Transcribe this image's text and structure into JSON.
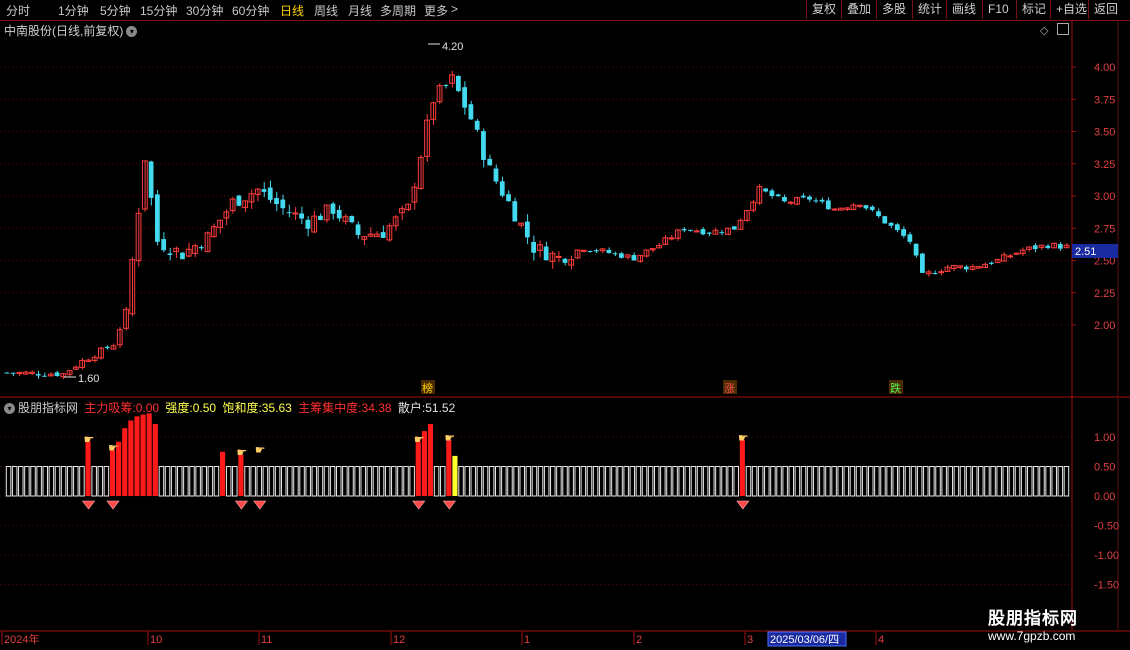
{
  "toolbar": {
    "periods": [
      "分时",
      "1分钟",
      "5分钟",
      "15分钟",
      "30分钟",
      "60分钟",
      "日线",
      "周线",
      "月线",
      "多周期",
      "更多"
    ],
    "active_period": "日线",
    "more_arrow": ">",
    "right_buttons": [
      "复权",
      "叠加",
      "多股",
      "统计",
      "画线",
      "F10",
      "标记",
      "+自选",
      "返回"
    ]
  },
  "main_panel": {
    "title": "中南股份(日线,前复权)",
    "high_label": "4.20",
    "low_label": "1.60",
    "current_price": "2.51",
    "y_ticks": [
      "4.00",
      "3.75",
      "3.50",
      "3.25",
      "3.00",
      "2.75",
      "2.50",
      "2.25",
      "2.00"
    ],
    "markers": [
      "榜",
      "涨",
      "跌"
    ]
  },
  "indicator_panel": {
    "name": "股朋指标网",
    "fields": [
      {
        "label": "主力吸筹:",
        "value": "0.00",
        "color": "#ff3030"
      },
      {
        "label": "强度:",
        "value": "0.50",
        "color": "#ffff50"
      },
      {
        "label": "饱和度:",
        "value": "35.63",
        "color": "#ffff50"
      },
      {
        "label": "主筹集中度:",
        "value": "34.38",
        "color": "#ff3030"
      },
      {
        "label": "散户:",
        "value": "51.52",
        "color": "#e0e0e0"
      }
    ],
    "y_ticks": [
      "1.00",
      "0.50",
      "0.00",
      "-0.50",
      "-1.00",
      "-1.50"
    ]
  },
  "time_axis": {
    "labels": [
      "2024年",
      "10",
      "11",
      "12",
      "1",
      "2",
      "3",
      "4"
    ],
    "cursor_date": "2025/03/06/四"
  },
  "watermark": {
    "title": "股朋指标网",
    "url": "www.7gpzb.com"
  },
  "colors": {
    "up": "#ff3d3d",
    "down": "#43d9ef",
    "axis": "#a01010",
    "text": "#c8c8c8",
    "highlight": "#ffd200"
  },
  "chart_data": {
    "type": "candlestick",
    "price_axis": [
      2.0,
      4.0
    ],
    "trend_points": [
      [
        0,
        1.63
      ],
      [
        9,
        1.62
      ],
      [
        12,
        1.72
      ],
      [
        17,
        1.85
      ],
      [
        19,
        2.1
      ],
      [
        22,
        3.3
      ],
      [
        24,
        2.65
      ],
      [
        28,
        2.55
      ],
      [
        32,
        2.68
      ],
      [
        36,
        2.95
      ],
      [
        40,
        3.05
      ],
      [
        44,
        2.9
      ],
      [
        48,
        2.8
      ],
      [
        52,
        2.9
      ],
      [
        56,
        2.7
      ],
      [
        60,
        2.72
      ],
      [
        64,
        2.9
      ],
      [
        68,
        3.75
      ],
      [
        71,
        3.9
      ],
      [
        74,
        3.6
      ],
      [
        77,
        3.2
      ],
      [
        80,
        2.95
      ],
      [
        84,
        2.6
      ],
      [
        88,
        2.52
      ],
      [
        92,
        2.6
      ],
      [
        96,
        2.56
      ],
      [
        100,
        2.52
      ],
      [
        104,
        2.62
      ],
      [
        108,
        2.75
      ],
      [
        112,
        2.72
      ],
      [
        116,
        2.75
      ],
      [
        120,
        3.05
      ],
      [
        124,
        2.95
      ],
      [
        128,
        2.98
      ],
      [
        132,
        2.9
      ],
      [
        136,
        2.95
      ],
      [
        140,
        2.8
      ],
      [
        144,
        2.65
      ],
      [
        146,
        2.38
      ],
      [
        150,
        2.45
      ],
      [
        154,
        2.45
      ],
      [
        158,
        2.5
      ],
      [
        162,
        2.58
      ],
      [
        166,
        2.62
      ],
      [
        170,
        2.6
      ]
    ],
    "indicator": {
      "bar_count": 174,
      "zero_value": 0.0,
      "white_bar_top": 0.5
    }
  }
}
